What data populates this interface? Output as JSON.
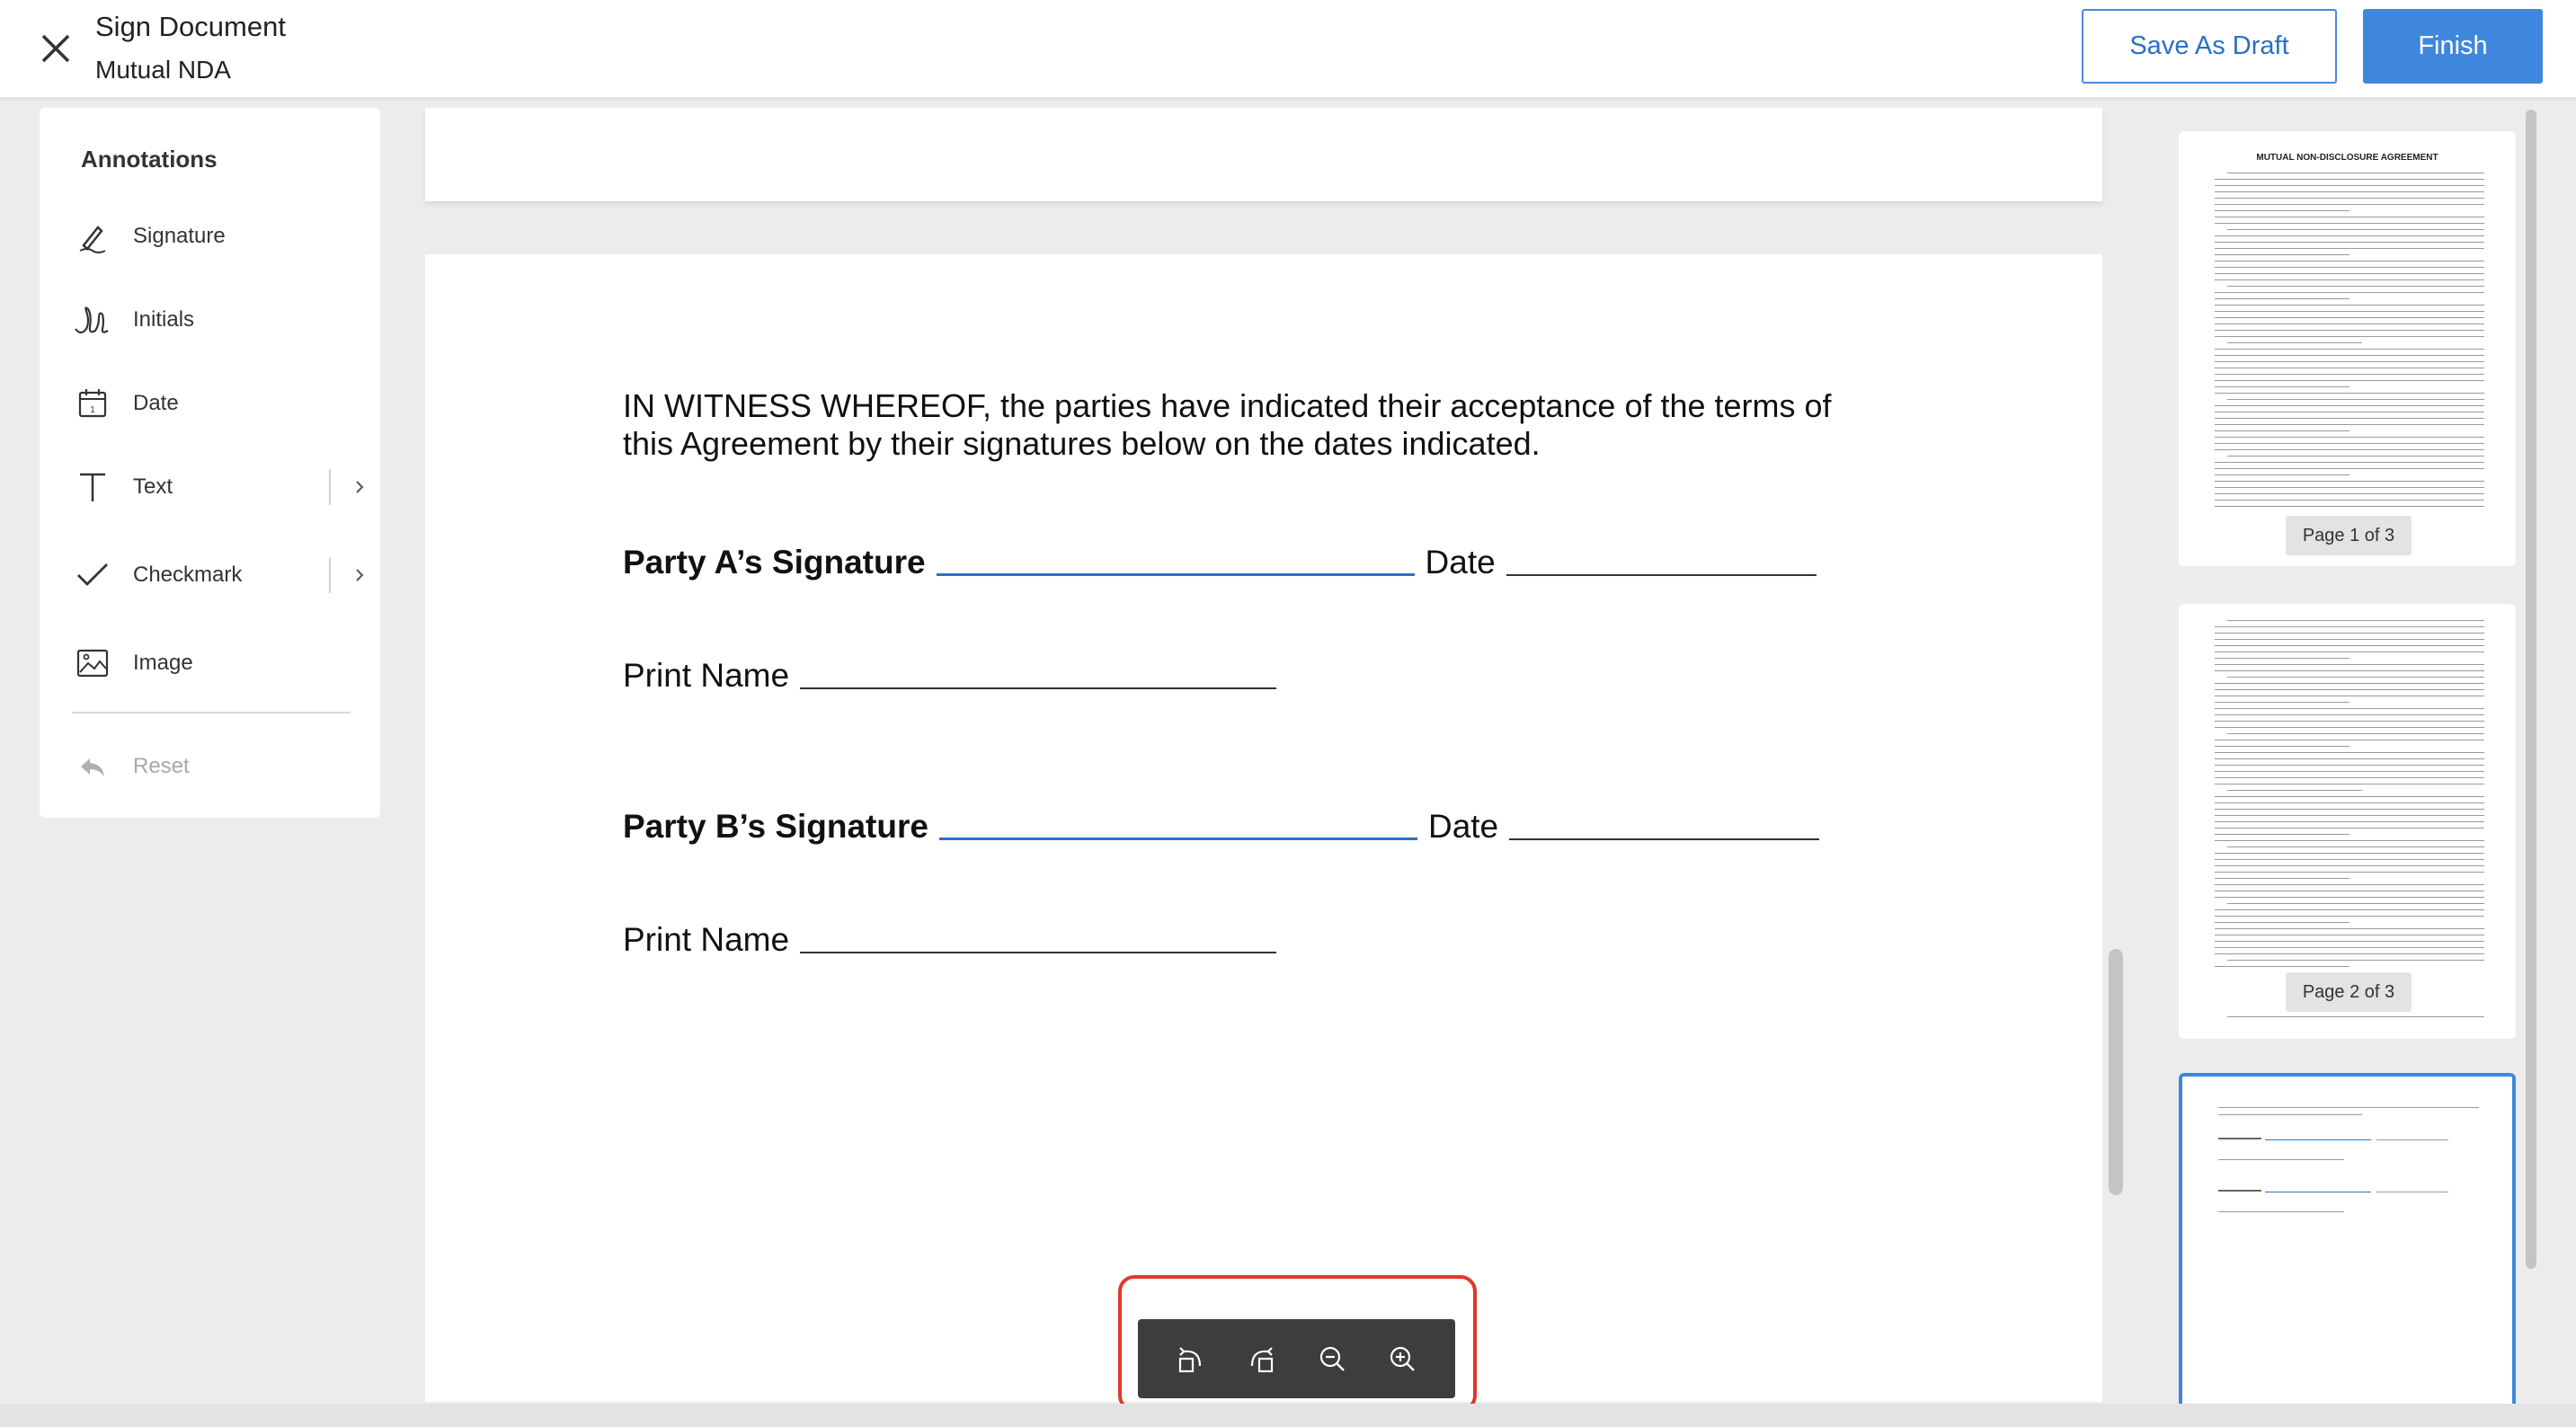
{
  "header": {
    "title": "Sign Document",
    "subtitle": "Mutual NDA",
    "save_draft_label": "Save As Draft",
    "finish_label": "Finish"
  },
  "annotations": {
    "title": "Annotations",
    "items": [
      {
        "label": "Signature",
        "icon": "pen-icon"
      },
      {
        "label": "Initials",
        "icon": "initials-icon"
      },
      {
        "label": "Date",
        "icon": "calendar-icon"
      },
      {
        "label": "Text",
        "icon": "text-icon"
      },
      {
        "label": "Checkmark",
        "icon": "checkmark-icon"
      },
      {
        "label": "Image",
        "icon": "image-icon"
      }
    ],
    "reset_label": "Reset"
  },
  "document": {
    "witness_text": "IN WITNESS WHEREOF, the parties have indicated their acceptance of the terms of this Agreement by their signatures below on the dates indicated.",
    "party_a_label": "Party A’s Signature",
    "party_b_label": "Party B’s Signature",
    "date_label": "Date",
    "print_name_label": "Print Name",
    "underscores_name": "___________________________",
    "underscores_date": "________________"
  },
  "thumbnails": {
    "page1_title": "MUTUAL NON-DISCLOSURE AGREEMENT",
    "pages": [
      {
        "label": "Page 1 of 3"
      },
      {
        "label": "Page 2 of 3"
      }
    ]
  },
  "colors": {
    "accent": "#3f86dd",
    "signature_line": "#2a6fc9",
    "highlight": "#e0372c",
    "toolbar_bg": "#3d3d3d"
  }
}
